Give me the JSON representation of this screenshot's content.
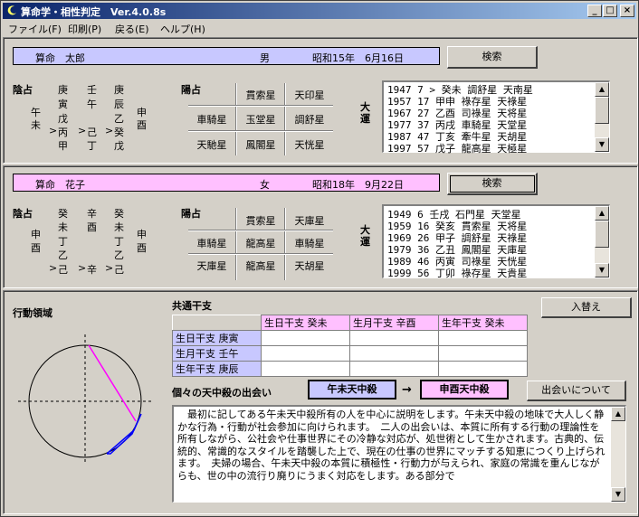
{
  "app": {
    "title": "算命学・相性判定　Ver.4.0.8s"
  },
  "window_controls": {
    "minimize": "_",
    "maximize": "□",
    "close": "×"
  },
  "menu": [
    {
      "label": "ファイル(F)"
    },
    {
      "label": "印刷(P)"
    },
    {
      "label": "戻る(E)"
    },
    {
      "label": "ヘルプ(H)"
    }
  ],
  "person1": {
    "name": "算命　太郎",
    "gender": "男",
    "birth": "昭和15年　6月16日",
    "search_label": "検索",
    "inzen_label": "陰占",
    "col1": [
      "午",
      "未"
    ],
    "col2": [
      "庚",
      "寅",
      "戊",
      "丙",
      "甲"
    ],
    "col3": [
      "壬",
      "午",
      "己",
      "丁"
    ],
    "col4": [
      "庚",
      "辰",
      "乙",
      "癸",
      "戊"
    ],
    "col5": [
      "申",
      "酉"
    ],
    "marks": [
      ">",
      ">",
      ">"
    ],
    "yosen_label": "陽占",
    "yosen": [
      [
        "",
        "貫索星",
        "天印星"
      ],
      [
        "車騎星",
        "玉堂星",
        "調舒星"
      ],
      [
        "天馳星",
        "鳳閣星",
        "天恍星"
      ]
    ],
    "taiun_label": "大運",
    "taiun": [
      "1947  7 >  癸未  調舒星  天南星",
      "1957 17    甲申  祿存星  天祿星",
      "1967 27    乙酉  司祿星  天将星",
      "1977 37    丙戌  車騎星  天堂星",
      "1987 47    丁亥  牽牛星  天胡星",
      "1997 57    戊子  龍高星  天極星"
    ]
  },
  "person2": {
    "name": "算命　花子",
    "gender": "女",
    "birth": "昭和18年　9月22日",
    "search_label": "検索",
    "inzen_label": "陰占",
    "col1": [
      "申",
      "酉"
    ],
    "col2": [
      "癸",
      "未",
      "丁",
      "乙",
      "己"
    ],
    "col3": [
      "辛",
      "酉",
      "辛"
    ],
    "col4": [
      "癸",
      "未",
      "丁",
      "乙",
      "己"
    ],
    "col5": [
      "申",
      "酉"
    ],
    "marks": [
      ">",
      ">",
      ">"
    ],
    "yosen_label": "陽占",
    "yosen": [
      [
        "",
        "貫索星",
        "天庫星"
      ],
      [
        "車騎星",
        "龍高星",
        "車騎星"
      ],
      [
        "天庫星",
        "龍高星",
        "天胡星"
      ]
    ],
    "taiun_label": "大運",
    "taiun": [
      "1949  6    壬戌  石門星  天堂星",
      "1959 16    癸亥  貫索星  天将星",
      "1969 26    甲子  調舒星  天祿星",
      "1979 36    乙丑  鳳閣星  天庫星",
      "1989 46    丙寅  司祿星  天恍星",
      "1999 56    丁卯  祿存星  天貴星"
    ]
  },
  "bottom": {
    "action_area_label": "行動領域",
    "kyotsu_label": "共通干支",
    "swap_label": "入替え",
    "table_headers": [
      "生日干支 癸未",
      "生月干支 辛酉",
      "生年干支 癸未"
    ],
    "table_rows": [
      "生日干支 庚寅",
      "生月干支 壬午",
      "生年干支 庚辰"
    ],
    "tenchusatsu_label": "個々の天中殺の出会い",
    "tenchu1": "午未天中殺",
    "arrow": "→",
    "tenchu2": "申酉天中殺",
    "about_label": "出会いについて",
    "description": "　最初に記してある午未天中殺所有の人を中心に説明をします。午未天中殺の地味で大人しく静かな行為・行動が社会参加に向けられます。　二人の出会いは、本質に所有する行動の理論性を所有しながら、公社会や仕事世界にその冷静な対応が、処世術として生かされます。古典的、伝統的、常識的なスタイルを踏襲した上で、現在の仕事の世界にマッチする知恵につくり上げられます。　夫婦の場合、午未天中殺の本質に積極性・行動力が与えられ、家庭の常識を重んじながらも、世の中の流行り廃りにうまく対応をします。ある部分で"
  },
  "colors": {
    "person1_bar": "#c8c8ff",
    "person2_bar": "#ffc0ff",
    "table_side": "#c8c8ff",
    "table_head": "#ffc0ff",
    "line_magenta": "#ff00ff",
    "line_blue": "#0000ff"
  }
}
